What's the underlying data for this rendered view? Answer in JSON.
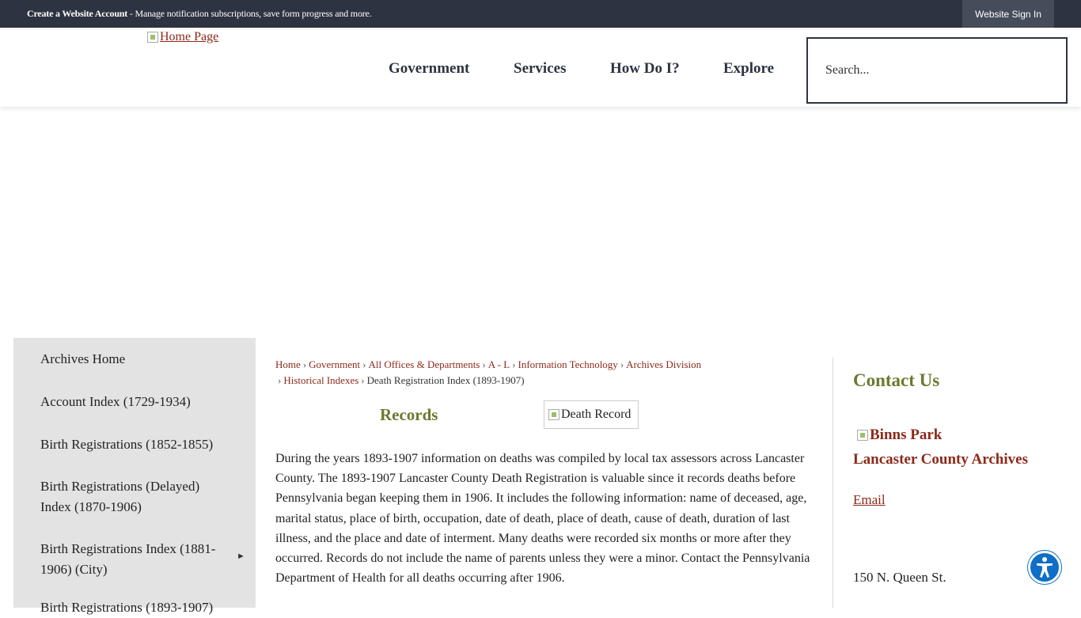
{
  "topbar": {
    "create_account": "Create a Website Account",
    "notice_rest": " - Manage notification subscriptions, save form progress and more.",
    "signin": "Website Sign In"
  },
  "header": {
    "logo_alt": "Home Page",
    "nav": [
      "Government",
      "Services",
      "How Do I?",
      "Explore"
    ],
    "search_placeholder": "Search..."
  },
  "sidebar": {
    "items": [
      "Archives Home",
      "Account Index (1729-1934)",
      "Birth Registrations (1852-1855)",
      "Birth Registrations (Delayed) Index (1870-1906)",
      "Birth Registrations Index (1881-1906) (City)",
      "Birth Registrations (1893-1907)"
    ],
    "expand_arrow": "►"
  },
  "breadcrumb": {
    "items": [
      "Home",
      "Government",
      "All Offices & Departments",
      "A - L",
      "Information Technology",
      "Archives Division",
      "Historical Indexes"
    ],
    "current": "Death Registration Index (1893-1907)",
    "separator": "›"
  },
  "main": {
    "records_title": "Records",
    "image_alt": "Death Record",
    "body": "During the years 1893-1907 information on deaths was compiled by local tax assessors across Lancaster County. The 1893-1907 Lancaster County Death Registration is valuable since it records deaths before Pennsylvania began keeping them in 1906. It includes the following information: name of deceased, age, marital status, place of birth, occupation, date of death, place of death, cause of death, duration of last illness, and the place and date of interment. Many deaths were recorded six months or more after they occurred. Records do not include the name of parents unless they were a minor. Contact the Pennsylvania Department of Health for all deaths occurring after 1906."
  },
  "contact": {
    "title": "Contact Us",
    "image_alt": "Binns Park",
    "name": "Lancaster County Archives",
    "email": "Email",
    "address": "150 N. Queen St."
  },
  "colors": {
    "topbar": "#2d3340",
    "accent_green": "#6b7a2f",
    "link_red": "#8b2a1a",
    "sidebar_bg": "#e3e3e3",
    "a11y_blue": "#0f6fc6"
  },
  "icons": {
    "accessibility": "accessibility-icon",
    "expand": "triangle-right-icon"
  }
}
